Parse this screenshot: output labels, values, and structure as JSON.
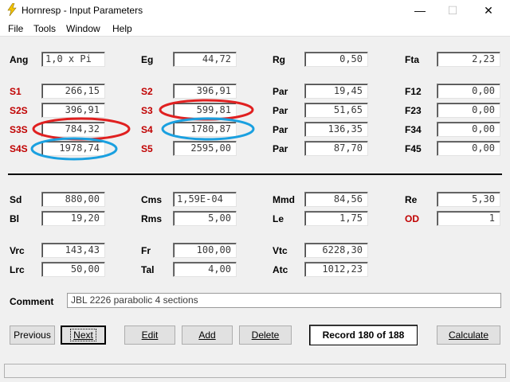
{
  "window": {
    "title": "Hornresp - Input Parameters",
    "min": "—",
    "max": "☐",
    "close": "✕"
  },
  "menu": {
    "file": "File",
    "tools": "Tools",
    "window": "Window",
    "help": "Help"
  },
  "params": {
    "ang": {
      "label": "Ang",
      "value": "1,0 x Pi"
    },
    "eg": {
      "label": "Eg",
      "value": "44,72"
    },
    "rg": {
      "label": "Rg",
      "value": "0,50"
    },
    "fta": {
      "label": "Fta",
      "value": "2,23"
    },
    "s1": {
      "label": "S1",
      "value": "266,15"
    },
    "s2": {
      "label": "S2",
      "value": "396,91"
    },
    "par1": {
      "label": "Par",
      "value": "19,45"
    },
    "f12": {
      "label": "F12",
      "value": "0,00"
    },
    "s2s": {
      "label": "S2S",
      "value": "396,91"
    },
    "s3": {
      "label": "S3",
      "value": "599,81"
    },
    "par2": {
      "label": "Par",
      "value": "51,65"
    },
    "f23": {
      "label": "F23",
      "value": "0,00"
    },
    "s3s": {
      "label": "S3S",
      "value": "784,32"
    },
    "s4": {
      "label": "S4",
      "value": "1780,87"
    },
    "par3": {
      "label": "Par",
      "value": "136,35"
    },
    "f34": {
      "label": "F34",
      "value": "0,00"
    },
    "s4s": {
      "label": "S4S",
      "value": "1978,74"
    },
    "s5": {
      "label": "S5",
      "value": "2595,00"
    },
    "par4": {
      "label": "Par",
      "value": "87,70"
    },
    "f45": {
      "label": "F45",
      "value": "0,00"
    },
    "sd": {
      "label": "Sd",
      "value": "880,00"
    },
    "cms": {
      "label": "Cms",
      "value": "1,59E-04"
    },
    "mmd": {
      "label": "Mmd",
      "value": "84,56"
    },
    "re": {
      "label": "Re",
      "value": "5,30"
    },
    "bl": {
      "label": "Bl",
      "value": "19,20"
    },
    "rms": {
      "label": "Rms",
      "value": "5,00"
    },
    "le": {
      "label": "Le",
      "value": "1,75"
    },
    "od": {
      "label": "OD",
      "value": "1"
    },
    "vrc": {
      "label": "Vrc",
      "value": "143,43"
    },
    "fr": {
      "label": "Fr",
      "value": "100,00"
    },
    "vtc": {
      "label": "Vtc",
      "value": "6228,30"
    },
    "lrc": {
      "label": "Lrc",
      "value": "50,00"
    },
    "tal": {
      "label": "Tal",
      "value": "4,00"
    },
    "atc": {
      "label": "Atc",
      "value": "1012,23"
    }
  },
  "comment": {
    "label": "Comment",
    "value": "JBL 2226 parabolic 4 sections"
  },
  "buttons": {
    "previous": "Previous",
    "next": "Next",
    "edit": "Edit",
    "add": "Add",
    "delete": "Delete",
    "calculate": "Calculate"
  },
  "record": "Record 180 of 188",
  "colors": {
    "red_label": "#c00000",
    "red_circle": "#e02020",
    "blue_circle": "#1aa0e0"
  }
}
